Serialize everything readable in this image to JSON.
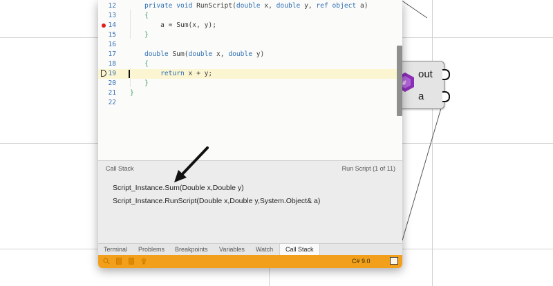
{
  "canvas": {
    "component": {
      "outputs": [
        "out",
        "a"
      ]
    }
  },
  "editor": {
    "code_lines": [
      {
        "no": "12",
        "tokens": [
          [
            "kw",
            "private "
          ],
          [
            "kw",
            "void "
          ],
          [
            "t",
            "RunScript("
          ],
          [
            "kw",
            "double "
          ],
          [
            "t",
            "x, "
          ],
          [
            "kw",
            "double "
          ],
          [
            "t",
            "y, "
          ],
          [
            "kw",
            "ref "
          ],
          [
            "kw",
            "object "
          ],
          [
            "t",
            "a)"
          ]
        ]
      },
      {
        "no": "13",
        "tokens": [
          [
            "brace",
            "{"
          ]
        ]
      },
      {
        "no": "14",
        "tokens": [
          [
            "t",
            "    a = Sum(x, y);"
          ]
        ],
        "breakpoint": true
      },
      {
        "no": "15",
        "tokens": [
          [
            "brace",
            "}"
          ]
        ]
      },
      {
        "no": "16",
        "tokens": []
      },
      {
        "no": "17",
        "tokens": [
          [
            "kw",
            "double "
          ],
          [
            "t",
            "Sum("
          ],
          [
            "kw",
            "double "
          ],
          [
            "t",
            "x, "
          ],
          [
            "kw",
            "double "
          ],
          [
            "t",
            "y)"
          ]
        ]
      },
      {
        "no": "18",
        "tokens": [
          [
            "brace",
            "{"
          ]
        ]
      },
      {
        "no": "19",
        "tokens": [
          [
            "t",
            "    "
          ],
          [
            "kw",
            "return "
          ],
          [
            "t",
            "x + y;"
          ]
        ],
        "current": true
      },
      {
        "no": "20",
        "tokens": [
          [
            "brace",
            "}"
          ]
        ]
      },
      {
        "no": "21",
        "tokens": [
          [
            "brace",
            "}"
          ]
        ],
        "outer": true
      },
      {
        "no": "22",
        "tokens": []
      }
    ]
  },
  "panel": {
    "title": "Call Stack",
    "run_script": "Run Script (1 of 11)",
    "stack": [
      "Script_Instance.Sum(Double x,Double y)",
      "Script_Instance.RunScript(Double x,Double y,System.Object& a)"
    ]
  },
  "tabs": [
    "Terminal",
    "Problems",
    "Breakpoints",
    "Variables",
    "Watch",
    "Call Stack"
  ],
  "active_tab": "Call Stack",
  "status": {
    "language": "C# 9.0",
    "icons": [
      "search-icon",
      "document-icon",
      "document-icon",
      "bulb-icon"
    ],
    "accent": "#f2a01c"
  }
}
